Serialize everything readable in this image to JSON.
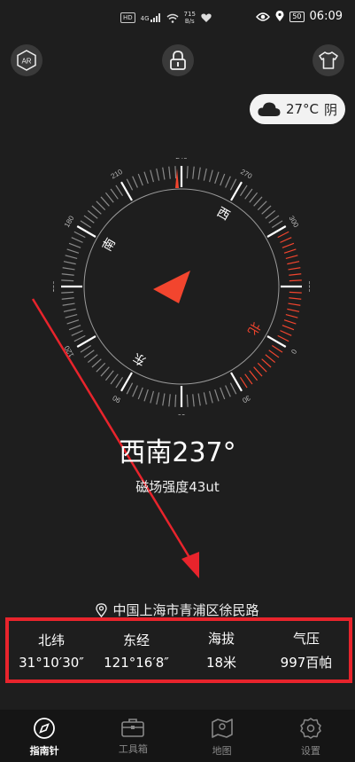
{
  "status_bar": {
    "hd": "HD",
    "network": "4G",
    "net_speed_value": "715",
    "net_speed_unit": "B/s",
    "battery": "50",
    "time": "06:09"
  },
  "top": {
    "ar_label": "AR"
  },
  "weather": {
    "temperature": "27°C",
    "condition": "阴"
  },
  "compass": {
    "degree_labels": [
      "240",
      "270",
      "300",
      "330",
      "0",
      "30",
      "60",
      "90",
      "120",
      "150",
      "180",
      "210"
    ],
    "cardinal_labels": {
      "north": "北",
      "east": "东",
      "south": "南",
      "west": "西"
    }
  },
  "heading": {
    "text": "西南237°"
  },
  "magnetic": {
    "text": "磁场强度43ut"
  },
  "location": {
    "text": "中国上海市青浦区徐民路"
  },
  "stats": [
    {
      "label": "北纬",
      "value": "31°10′30″"
    },
    {
      "label": "东经",
      "value": "121°16′8″"
    },
    {
      "label": "海拔",
      "value": "18米"
    },
    {
      "label": "气压",
      "value": "997百帕"
    }
  ],
  "tabs": [
    {
      "label": "指南针",
      "icon": "compass-icon"
    },
    {
      "label": "工具箱",
      "icon": "toolbox-icon"
    },
    {
      "label": "地图",
      "icon": "map-icon"
    },
    {
      "label": "设置",
      "icon": "settings-icon"
    }
  ],
  "colors": {
    "accent_red": "#f2452e",
    "highlight_border": "#e8242c",
    "background": "#1e1e1e"
  }
}
